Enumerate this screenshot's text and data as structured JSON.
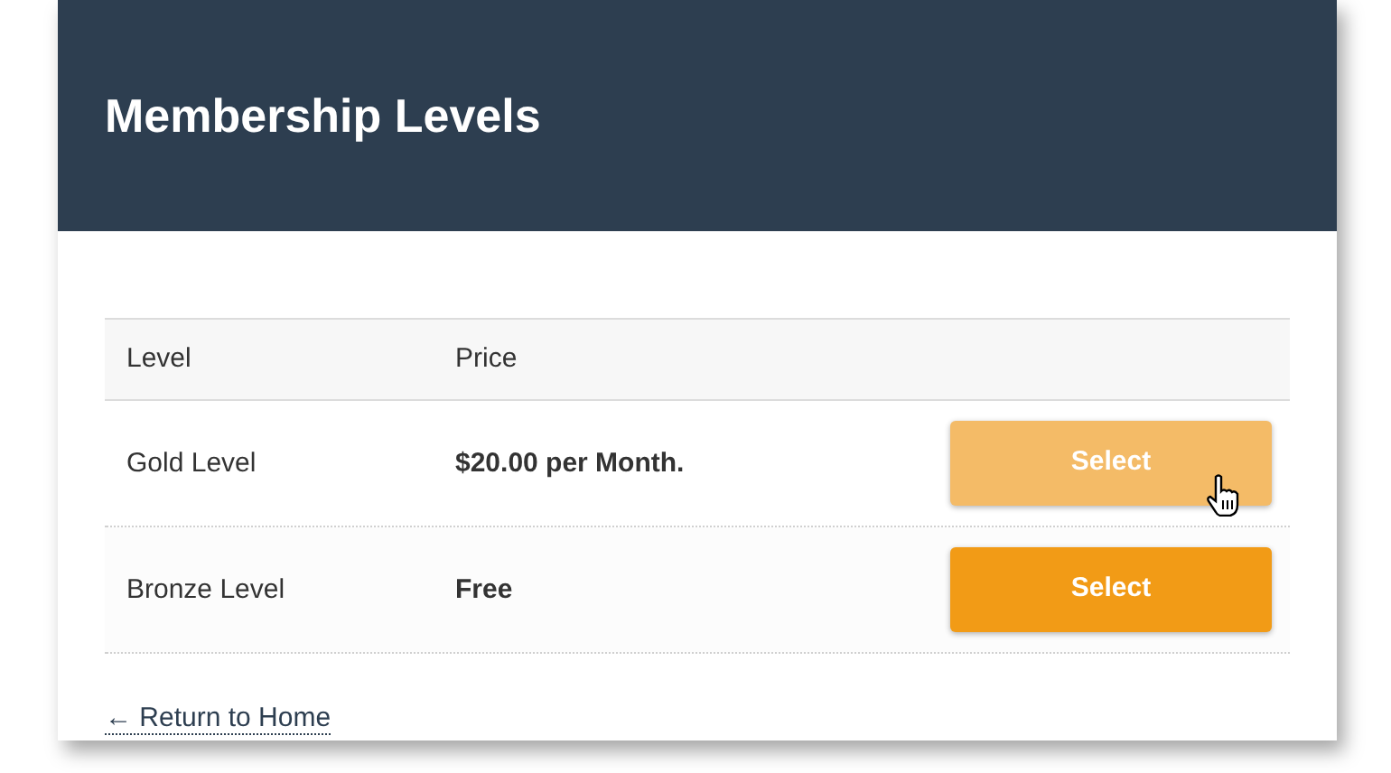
{
  "header": {
    "title": "Membership Levels"
  },
  "table": {
    "columns": [
      "Level",
      "Price"
    ],
    "rows": [
      {
        "level": "Gold Level",
        "price": "$20.00 per Month.",
        "button": "Select",
        "hovered": true
      },
      {
        "level": "Bronze Level",
        "price": "Free",
        "button": "Select",
        "hovered": false
      }
    ]
  },
  "return_link": "← Return to Home"
}
